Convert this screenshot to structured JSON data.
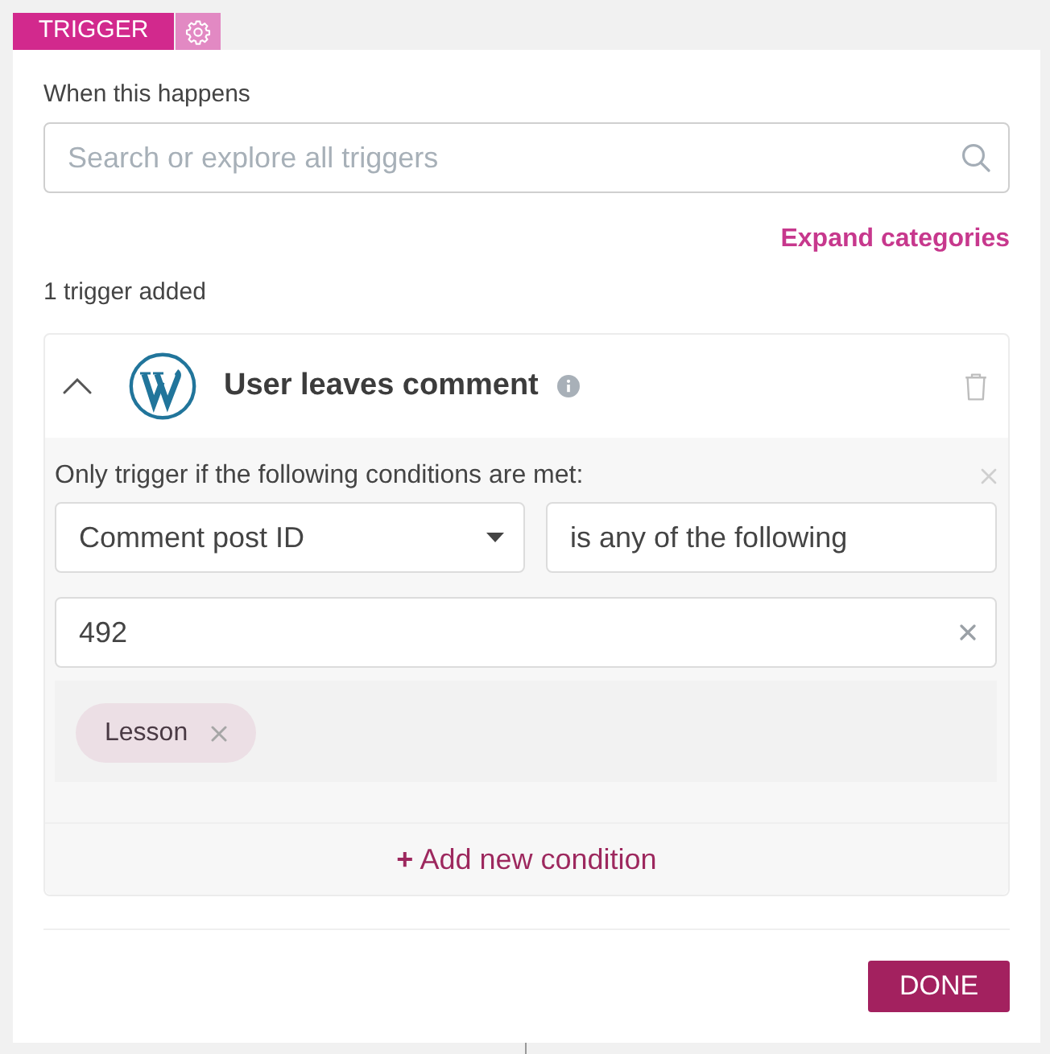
{
  "header": {
    "tab_label": "TRIGGER"
  },
  "panel": {
    "label": "When this happens",
    "search": {
      "placeholder": "Search or explore all triggers"
    },
    "expand_link": "Expand categories",
    "count": "1 trigger added"
  },
  "triggers": [
    {
      "title": "User leaves comment",
      "expanded": true,
      "conditions_heading": "Only trigger if the following conditions are met:",
      "conditions": [
        {
          "field": "Comment post ID",
          "operator": "is any of the following",
          "value": "492",
          "tags": [
            "Lesson"
          ]
        }
      ],
      "add_condition": "**+** Add new condition"
    }
  ],
  "done_button": "DONE"
}
